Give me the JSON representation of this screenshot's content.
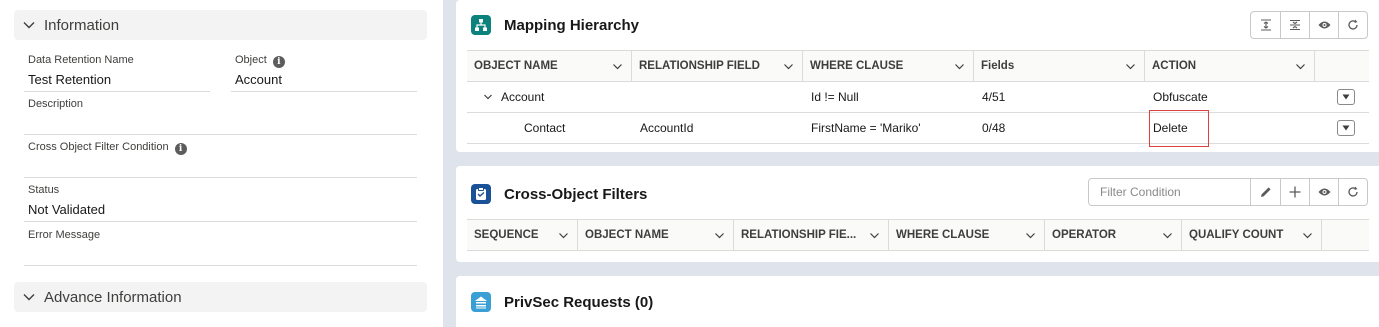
{
  "left_panel": {
    "information": {
      "header": "Information"
    },
    "fields": {
      "data_retention_name": {
        "label": "Data Retention Name",
        "value": "Test Retention"
      },
      "object": {
        "label": "Object",
        "value": "Account"
      },
      "description": {
        "label": "Description",
        "value": ""
      },
      "cross_object_filter_condition": {
        "label": "Cross Object Filter Condition",
        "value": ""
      },
      "status": {
        "label": "Status",
        "value": "Not Validated"
      },
      "error_message": {
        "label": "Error Message",
        "value": ""
      }
    },
    "advance_information": {
      "header": "Advance Information"
    }
  },
  "mapping_hierarchy": {
    "title": "Mapping Hierarchy",
    "columns": [
      "OBJECT NAME",
      "RELATIONSHIP FIELD",
      "WHERE CLAUSE",
      "Fields",
      "ACTION"
    ],
    "rows": [
      {
        "object_name": "Account",
        "relationship_field": "",
        "where_clause": "Id != Null",
        "fields": "4/51",
        "action": "Obfuscate",
        "expanded": true
      },
      {
        "object_name": "Contact",
        "relationship_field": "AccountId",
        "where_clause": "FirstName = 'Mariko'",
        "fields": "0/48",
        "action": "Delete",
        "highlighted": true
      }
    ],
    "toolbar_icons": [
      "expand-all-icon",
      "collapse-all-icon",
      "eye-icon",
      "refresh-icon"
    ]
  },
  "cross_object_filters": {
    "title": "Cross-Object Filters",
    "filter_placeholder": "Filter Condition",
    "columns": [
      "SEQUENCE",
      "OBJECT NAME",
      "RELATIONSHIP FIE...",
      "WHERE CLAUSE",
      "OPERATOR",
      "QUALIFY COUNT"
    ],
    "toolbar_icons": [
      "pencil-icon",
      "plus-icon",
      "eye-icon",
      "refresh-icon"
    ]
  },
  "privsec_requests": {
    "title": "PrivSec Requests (0)"
  },
  "colors": {
    "mapping_icon": "#0b827c",
    "filters_icon": "#1b5297",
    "privsec_icon": "#3a9fd4",
    "highlight": "#e04040"
  }
}
